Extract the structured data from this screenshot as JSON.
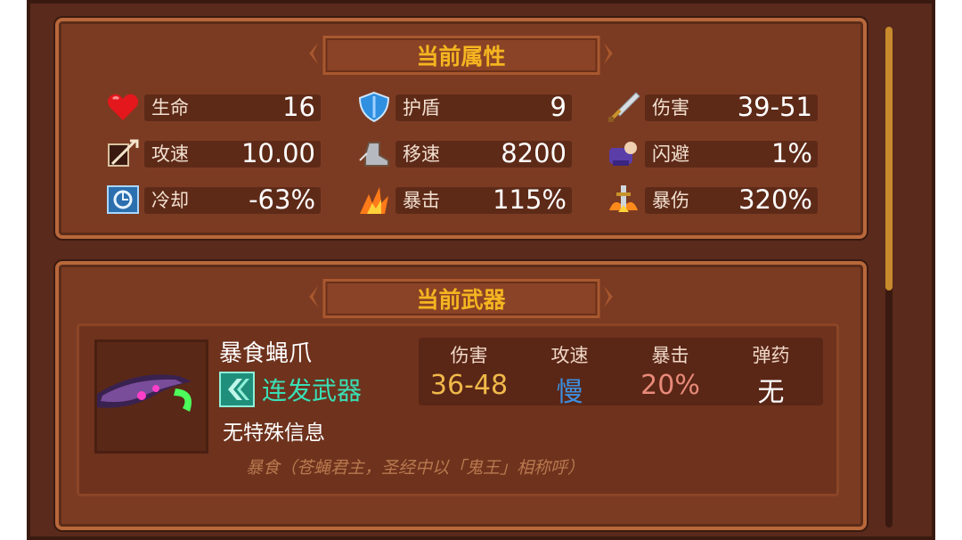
{
  "attributes": {
    "title": "当前属性",
    "stats": [
      {
        "label": "生命",
        "value": "16",
        "icon": "heart-icon"
      },
      {
        "label": "护盾",
        "value": "9",
        "icon": "shield-icon"
      },
      {
        "label": "伤害",
        "value": "39-51",
        "icon": "sword-icon"
      },
      {
        "label": "攻速",
        "value": "10.00",
        "icon": "attack-speed-icon"
      },
      {
        "label": "移速",
        "value": "8200",
        "icon": "boot-icon"
      },
      {
        "label": "闪避",
        "value": "1%",
        "icon": "dodge-icon"
      },
      {
        "label": "冷却",
        "value": "-63%",
        "icon": "cooldown-icon"
      },
      {
        "label": "暴击",
        "value": "115%",
        "icon": "crit-icon"
      },
      {
        "label": "暴伤",
        "value": "320%",
        "icon": "crit-damage-icon"
      }
    ]
  },
  "weapon": {
    "title": "当前武器",
    "name": "暴食蝇爪",
    "type": "连发武器",
    "note": "无特殊信息",
    "flavor": "暴食（苍蝇君主，圣经中以「鬼王」相称呼）",
    "stats": [
      {
        "label": "伤害",
        "value": "36-48",
        "color": "#f0b94a"
      },
      {
        "label": "攻速",
        "value": "慢",
        "color": "#3c8fe0"
      },
      {
        "label": "暴击",
        "value": "20%",
        "color": "#e88a7a"
      },
      {
        "label": "弹药",
        "value": "无",
        "color": "#ffffff"
      }
    ]
  },
  "colors": {
    "accent": "#f5b520",
    "panel": "#7b3b22",
    "type": "#39e0b6"
  }
}
